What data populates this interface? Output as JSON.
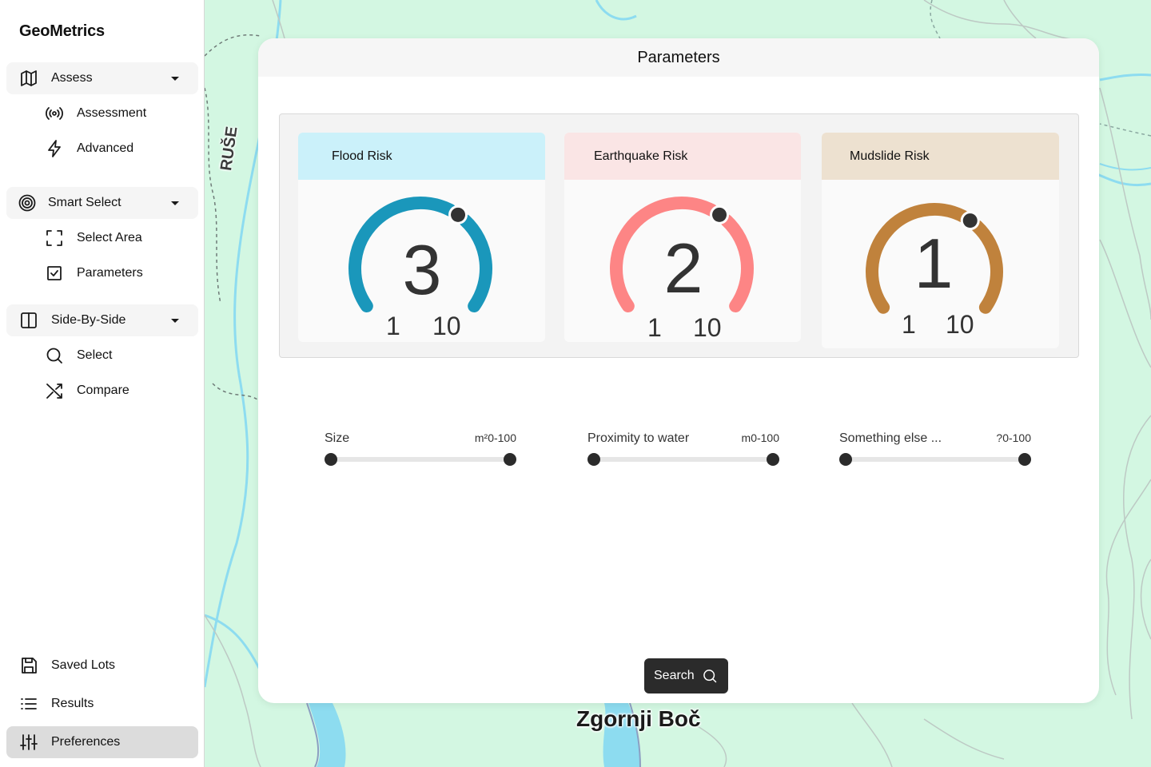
{
  "app": {
    "title": "GeoMetrics"
  },
  "sidebar": {
    "groups": [
      {
        "label": "Assess",
        "icon": "map-icon",
        "items": [
          {
            "label": "Assessment",
            "icon": "broadcast-icon"
          },
          {
            "label": "Advanced",
            "icon": "lightning-icon"
          }
        ]
      },
      {
        "label": "Smart Select",
        "icon": "target-icon",
        "items": [
          {
            "label": "Select Area",
            "icon": "selection-frame-icon"
          },
          {
            "label": "Parameters",
            "icon": "checkbox-icon"
          }
        ]
      },
      {
        "label": "Side-By-Side",
        "icon": "split-pane-icon",
        "items": [
          {
            "label": "Select",
            "icon": "search-icon"
          },
          {
            "label": "Compare",
            "icon": "shuffle-icon"
          }
        ]
      }
    ],
    "bottom": [
      {
        "label": "Saved Lots",
        "icon": "floppy-disk-icon"
      },
      {
        "label": "Results",
        "icon": "list-icon"
      },
      {
        "label": "Preferences",
        "icon": "sliders-icon",
        "active": true
      }
    ]
  },
  "map": {
    "place_label": "Zgornji Boč",
    "town_label": "RUŠE"
  },
  "panel": {
    "title": "Parameters",
    "risks": [
      {
        "name": "Flood Risk",
        "value": "3",
        "min": "1",
        "max": "10",
        "level": 0.222,
        "color": "#1a97bb",
        "header_color": "#cbf1fa"
      },
      {
        "name": "Earthquake Risk",
        "value": "2",
        "min": "1",
        "max": "10",
        "level": 0.111,
        "color": "#fd8585",
        "header_color": "#fae5e5"
      },
      {
        "name": "Mudslide Risk",
        "value": "1",
        "min": "1",
        "max": "10",
        "level": 0.0,
        "color": "#c0823c",
        "header_color": "#ede1d0"
      }
    ],
    "sliders": [
      {
        "label": "Size",
        "unit": "m²",
        "range": "0-100"
      },
      {
        "label": "Proximity to water",
        "unit": "m",
        "range": "0-100"
      },
      {
        "label": "Something else ...",
        "unit": "?",
        "range": "0-100"
      }
    ],
    "search_label": "Search"
  }
}
